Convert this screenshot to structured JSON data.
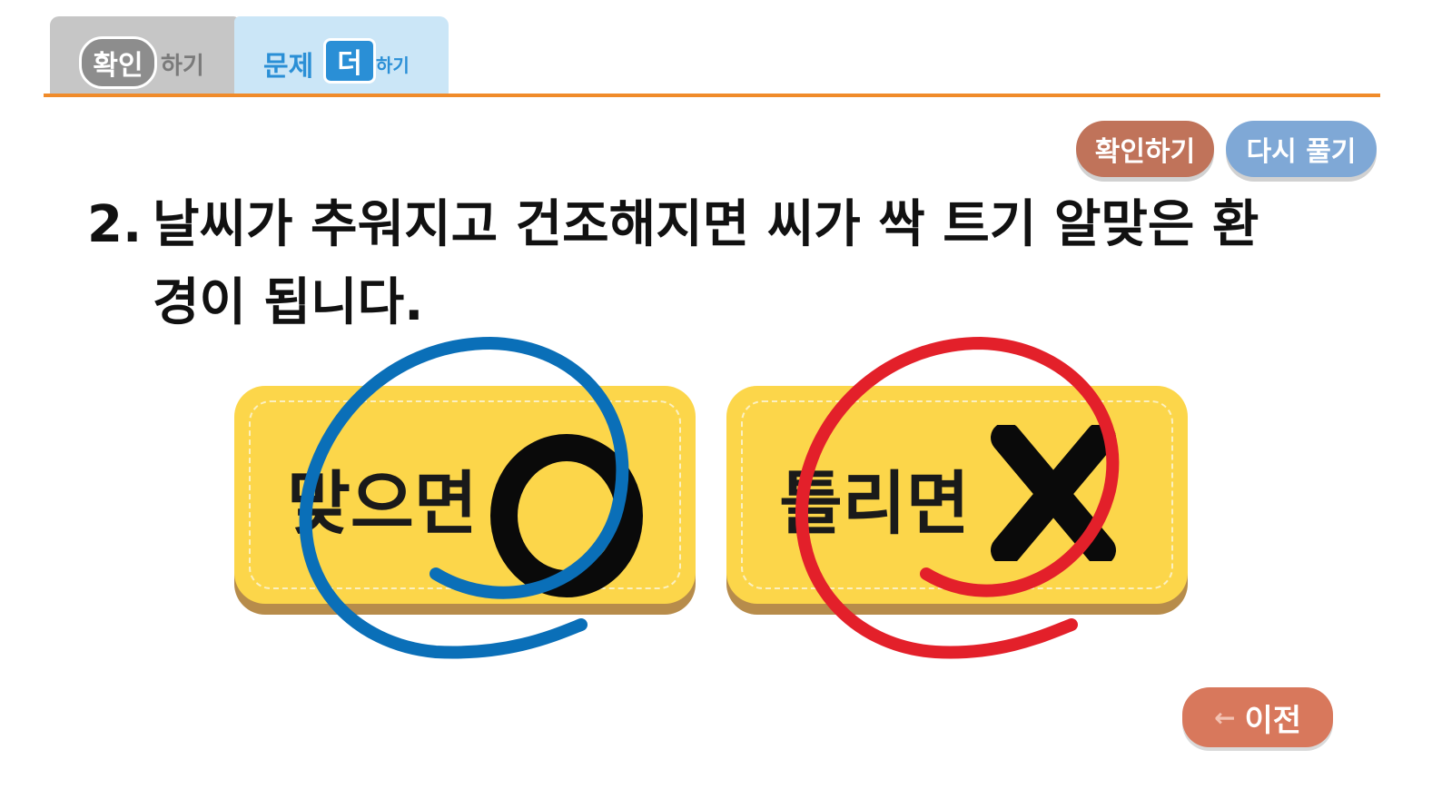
{
  "tabs": {
    "check": {
      "badge": "확인",
      "suffix": "하기"
    },
    "more": {
      "prefix": "문제",
      "badge": "더",
      "suffix": "하기"
    }
  },
  "toolbar": {
    "confirm_label": "확인하기",
    "retry_label": "다시 풀기"
  },
  "question": {
    "number": "2.",
    "line1": "날씨가 추워지고 건조해지면 씨가 싹 트기 알맞은 환",
    "line2": "경이 됩니다."
  },
  "answers": {
    "correct_label": "맞으면",
    "wrong_label": "틀리면"
  },
  "nav": {
    "prev_label": "이전",
    "prev_icon": "left-arrow-icon"
  },
  "colors": {
    "tab_orange_line": "#f08b2a",
    "answer_yellow": "#fcd64a",
    "blue_mark": "#0a6fb8",
    "red_mark": "#e3202a"
  }
}
